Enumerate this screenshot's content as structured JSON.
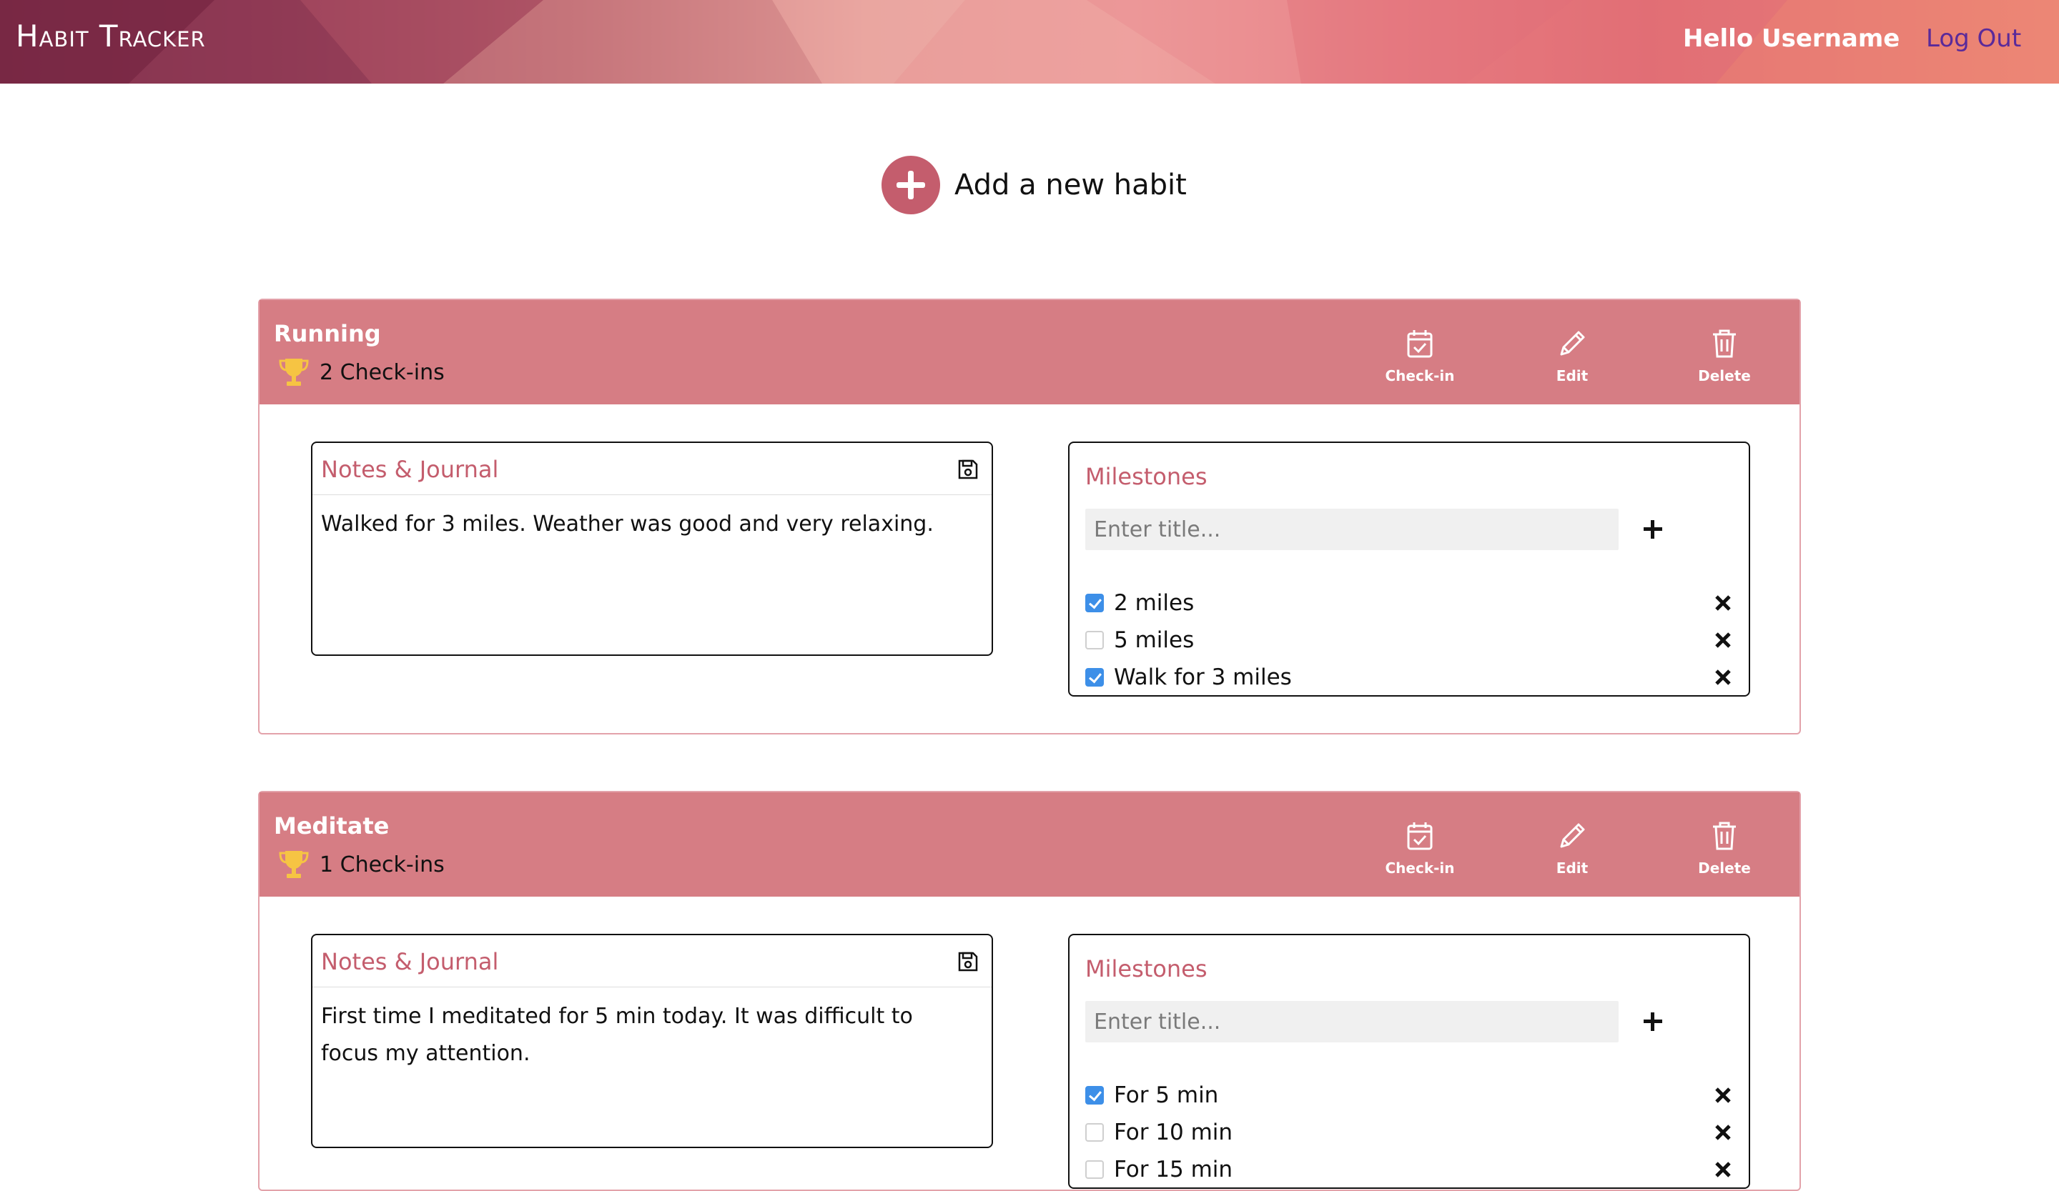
{
  "header": {
    "brand": "Habit Tracker",
    "greeting": "Hello Username",
    "logout_label": "Log Out"
  },
  "add_habit": {
    "label": "Add a new habit",
    "icon": "plus-circle-icon"
  },
  "actions": {
    "checkin_label": "Check-in",
    "edit_label": "Edit",
    "delete_label": "Delete"
  },
  "habits": [
    {
      "title": "Running",
      "checkins": "2 Check-ins",
      "notes_title": "Notes & Journal",
      "notes_text": "Walked for 3 miles. Weather was good and very relaxing.",
      "milestones_title": "Milestones",
      "milestone_placeholder": "Enter title...",
      "milestones": [
        {
          "label": "2 miles",
          "checked": true
        },
        {
          "label": "5 miles",
          "checked": false
        },
        {
          "label": "Walk for 3 miles",
          "checked": true
        }
      ]
    },
    {
      "title": "Meditate",
      "checkins": "1 Check-ins",
      "notes_title": "Notes & Journal",
      "notes_text": "First time I meditated for 5 min today. It was difficult to focus my attention.",
      "milestones_title": "Milestones",
      "milestone_placeholder": "Enter title...",
      "milestones": [
        {
          "label": "For 5 min",
          "checked": true
        },
        {
          "label": "For 10 min",
          "checked": false
        },
        {
          "label": "For 15 min",
          "checked": false
        }
      ]
    }
  ],
  "colors": {
    "accent": "#c45d6d",
    "card_header": "#d67d84",
    "checkbox_on": "#3d8fe8",
    "logout": "#5a2a9a"
  }
}
